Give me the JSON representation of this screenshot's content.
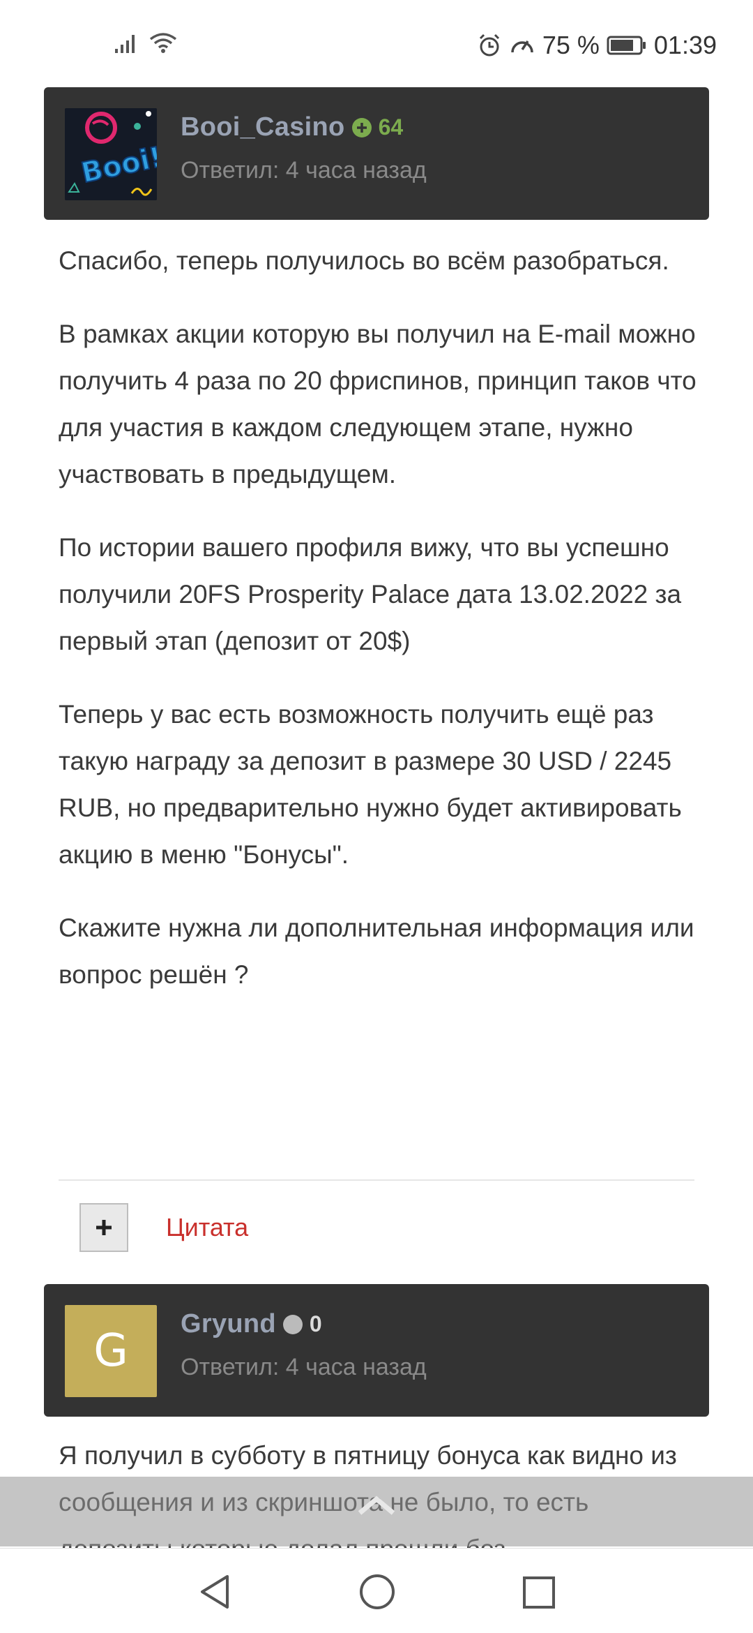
{
  "status_bar": {
    "battery_percent": "75 %",
    "time": "01:39",
    "icons": [
      "signal-icon",
      "wifi-icon",
      "alarm-icon",
      "data-saver-icon",
      "battery-icon"
    ]
  },
  "posts": [
    {
      "username": "Booi_Casino",
      "reputation": "64",
      "reputation_status": "positive",
      "reply_time": "Ответил: 4 часа назад",
      "avatar_text": "Booi!",
      "paragraphs": [
        "Спасибо, теперь получилось во всём разобраться.",
        "В рамках акции которую вы получил на E-mail можно получить 4 раза по 20 фриспинов, принцип таков что для участия в каждом следующем этапе, нужно участвовать в предыдущем.",
        "По истории вашего профиля вижу, что вы успешно получили 20FS Prosperity Palace дата 13.02.2022 за первый этап (депозит от 20$)",
        "Теперь у вас есть возможность получить ещё раз такую награду за депозит в размере 30 USD / 2245 RUB, но предварительно нужно будет активировать акцию в меню \"Бонусы\".",
        "Скажите нужна ли дополнительная информация или вопрос решён ?"
      ],
      "quote_label": "Цитата"
    },
    {
      "username": "Gryund",
      "reputation": "0",
      "reputation_status": "neutral",
      "reply_time": "Ответил: 4 часа назад",
      "avatar_letter": "G",
      "paragraphs": [
        "Я получил в субботу в пятницу бонуса как видно из сообщения и из скриншота не было, то есть депозиты которые делал прошли без"
      ]
    }
  ],
  "colors": {
    "header_bg": "#333333",
    "username": "#9aa3b4",
    "reputation_positive": "#7cac4e",
    "quote_link": "#c9302c",
    "avatar_letter_bg": "#c4ae5a"
  },
  "nav_bar": {
    "buttons": [
      "back-triangle-icon",
      "home-circle-icon",
      "recent-square-icon"
    ]
  }
}
